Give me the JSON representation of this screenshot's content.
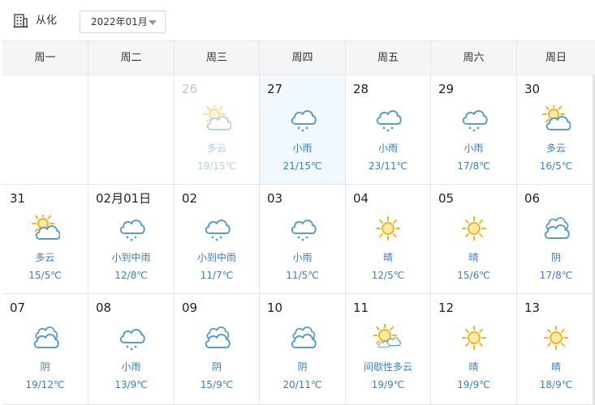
{
  "location": {
    "city": "从化",
    "icon": "building-icon"
  },
  "month_select": {
    "value": "2022年01月"
  },
  "weekdays": [
    "周一",
    "周二",
    "周三",
    "周四",
    "周五",
    "周六",
    "周日"
  ],
  "colors": {
    "sun": "#f5b324",
    "cloud": "#5b9bd0",
    "text_blue": "#3b7fc4",
    "today_bg": "#f2f9fe"
  },
  "days": [
    null,
    null,
    {
      "date": "26",
      "weather": "多云",
      "temp": "19/15℃",
      "icon": "partly-cloudy-icon",
      "state": "past"
    },
    {
      "date": "27",
      "weather": "小雨",
      "temp": "21/15℃",
      "icon": "rain-icon",
      "state": "today"
    },
    {
      "date": "28",
      "weather": "小雨",
      "temp": "23/11℃",
      "icon": "rain-icon"
    },
    {
      "date": "29",
      "weather": "小雨",
      "temp": "17/8℃",
      "icon": "rain-icon"
    },
    {
      "date": "30",
      "weather": "多云",
      "temp": "16/5℃",
      "icon": "partly-cloudy-icon"
    },
    {
      "date": "31",
      "weather": "多云",
      "temp": "15/5℃",
      "icon": "partly-cloudy-icon"
    },
    {
      "date": "02月01日",
      "weather": "小到中雨",
      "temp": "12/8℃",
      "icon": "rain-icon"
    },
    {
      "date": "02",
      "weather": "小到中雨",
      "temp": "11/7℃",
      "icon": "rain-icon"
    },
    {
      "date": "03",
      "weather": "小雨",
      "temp": "11/5℃",
      "icon": "rain-icon"
    },
    {
      "date": "04",
      "weather": "晴",
      "temp": "12/5℃",
      "icon": "sun-icon"
    },
    {
      "date": "05",
      "weather": "晴",
      "temp": "15/6℃",
      "icon": "sun-icon"
    },
    {
      "date": "06",
      "weather": "阴",
      "temp": "17/8℃",
      "icon": "overcast-icon"
    },
    {
      "date": "07",
      "weather": "阴",
      "temp": "19/12℃",
      "icon": "overcast-icon"
    },
    {
      "date": "08",
      "weather": "小雨",
      "temp": "13/9℃",
      "icon": "rain-icon"
    },
    {
      "date": "09",
      "weather": "阴",
      "temp": "15/9℃",
      "icon": "overcast-icon"
    },
    {
      "date": "10",
      "weather": "阴",
      "temp": "20/11℃",
      "icon": "overcast-icon"
    },
    {
      "date": "11",
      "weather": "间歇性多云",
      "temp": "19/9℃",
      "icon": "intermittent-cloud-icon"
    },
    {
      "date": "12",
      "weather": "晴",
      "temp": "19/9℃",
      "icon": "sun-icon"
    },
    {
      "date": "13",
      "weather": "晴",
      "temp": "18/9℃",
      "icon": "sun-icon"
    }
  ]
}
